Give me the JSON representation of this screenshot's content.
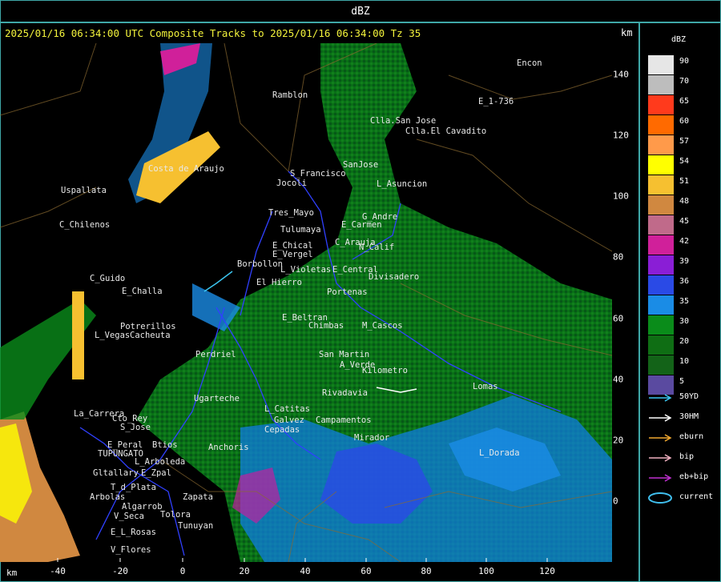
{
  "window": {
    "title": "dBZ"
  },
  "header": {
    "text": "2025/01/16 06:34:00 UTC Composite Tracks to 2025/01/16 06:34:00 Tz 35",
    "unit": "km"
  },
  "legend": {
    "title": "dBZ",
    "colors": [
      {
        "label": "90",
        "color": "#e6e6e6"
      },
      {
        "label": "70",
        "color": "#bdbdbd"
      },
      {
        "label": "65",
        "color": "#ff3a1c"
      },
      {
        "label": "60",
        "color": "#ff6a00"
      },
      {
        "label": "57",
        "color": "#ff9a4a"
      },
      {
        "label": "54",
        "color": "#ffff00"
      },
      {
        "label": "51",
        "color": "#f6c030"
      },
      {
        "label": "48",
        "color": "#d08840"
      },
      {
        "label": "45",
        "color": "#c06a8a"
      },
      {
        "label": "42",
        "color": "#d0209a"
      },
      {
        "label": "39",
        "color": "#8a1ed6"
      },
      {
        "label": "36",
        "color": "#2a4ae6"
      },
      {
        "label": "35",
        "color": "#1a8ce6"
      },
      {
        "label": "30",
        "color": "#0a8c1a"
      },
      {
        "label": "20",
        "color": "#0f6e14"
      },
      {
        "label": "10",
        "color": "#136318"
      },
      {
        "label": "5",
        "color": "#5a4aa0"
      }
    ],
    "tracks": [
      {
        "label": "50YD",
        "color": "#3cc6f0"
      },
      {
        "label": "30HM",
        "color": "#ffffff"
      },
      {
        "label": "eburn",
        "color": "#f0a830"
      },
      {
        "label": "bip",
        "color": "#f0b0c0"
      },
      {
        "label": "eb+bip",
        "color": "#c030d0"
      },
      {
        "label": "current",
        "color": "#40c0f0"
      }
    ]
  },
  "axes": {
    "x_label": "km",
    "x_ticks": [
      "-40",
      "-20",
      "0",
      "20",
      "40",
      "60",
      "80",
      "100",
      "120"
    ],
    "y_ticks": [
      "140",
      "120",
      "100",
      "80",
      "60",
      "40",
      "20",
      "0"
    ]
  },
  "places": [
    "Ramblon",
    "Encon",
    "E_1-736",
    "Clla.San Jose",
    "Clla.El Cavadito",
    "S_Francisco",
    "Jocoli",
    "SanJose",
    "L_Asuncion",
    "Uspallata",
    "Costa de Araujo",
    "Tres_Mayo",
    "G_Andre",
    "Tulumaya",
    "E_Carmen",
    "C_Chilenos",
    "E_Chical",
    "C_Arauja",
    "E_Vergel",
    "N_Calif",
    "Borbollon",
    "C_Guido",
    "L_Violetas",
    "E_Central",
    "El Hierro",
    "Divisadero",
    "E_Challa",
    "Portenas",
    "Potrerillos",
    "E_Beltran",
    "Chimbas",
    "M_Cascos",
    "L_Vegas",
    "Cacheuta",
    "San Martin",
    "Perdriel",
    "A_Verde",
    "Kilometro",
    "Lomas",
    "Rivadavia",
    "La_Carrera",
    "Cto_Rey",
    "S_Jose",
    "L_Catitas",
    "Ugarteche",
    "E_Peral",
    "Btios",
    "TUPUNGATO",
    "L_Arboleda",
    "Mirador",
    "Gltallary",
    "E_Zpal",
    "L_Dorada",
    "T_d_Plata",
    "Arbolas",
    "Zapata",
    "Algarrob",
    "Tolora",
    "V_Seca",
    "Tunuyan",
    "E_L_Rosas",
    "V_Flores",
    "Cepadas",
    "Galvez",
    "Anchoris",
    "Campamentos"
  ]
}
